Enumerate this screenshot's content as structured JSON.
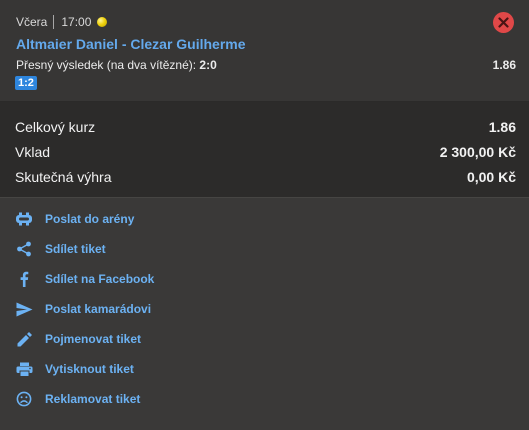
{
  "colors": {
    "accent": "#64a9ec",
    "close": "#e04848",
    "badge": "#2e86de",
    "ball": "#f0d20c"
  },
  "bet": {
    "day": "Včera",
    "time": "17:00",
    "match": "Altmaier Daniel - Clezar Guilherme",
    "pick_label": "Přesný výsledek (na dva vítězné): ",
    "pick_value": "2:0",
    "odds": "1.86",
    "score_badge": "1:2",
    "icons": {
      "live": "tennis-ball-icon",
      "close": "close-icon"
    }
  },
  "summary": {
    "rows": [
      {
        "label": "Celkový kurz",
        "value": "1.86"
      },
      {
        "label": "Vklad",
        "value": "2 300,00 Kč"
      },
      {
        "label": "Skutečná výhra",
        "value": "0,00 Kč"
      }
    ]
  },
  "actions": [
    {
      "label": "Poslat do arény",
      "icon": "arena-icon"
    },
    {
      "label": "Sdílet tiket",
      "icon": "share-icon"
    },
    {
      "label": "Sdílet na Facebook",
      "icon": "facebook-icon"
    },
    {
      "label": "Poslat kamarádovi",
      "icon": "send-icon"
    },
    {
      "label": "Pojmenovat tiket",
      "icon": "pencil-icon"
    },
    {
      "label": "Vytisknout tiket",
      "icon": "print-icon"
    },
    {
      "label": "Reklamovat tiket",
      "icon": "sad-face-icon"
    }
  ]
}
